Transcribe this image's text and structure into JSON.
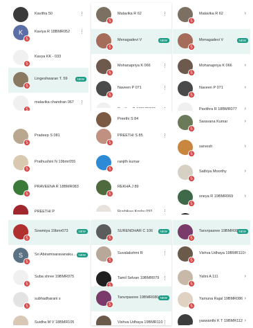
{
  "colors": {
    "accent": "#1c9c85",
    "badge": "#d94141",
    "active_row": "#e8f4f1"
  },
  "tiles": [
    {
      "rows": [
        {
          "name": "Kavitha 50",
          "avatar": "#3a3a3a",
          "badge": "",
          "trail": "⋮",
          "active": false
        },
        {
          "name": "Kaviya R 18BMR052",
          "avatar": "#5b6fa6",
          "avatar_letter": "K",
          "badge": "5",
          "trail": "⋮",
          "active": false
        },
        {
          "name": "Kavya KK - 033",
          "avatar": "#f0f0f0",
          "badge": "5",
          "trail": "",
          "active": false
        },
        {
          "name": "Lingeshwaran T. 59",
          "avatar": "#8a7a62",
          "badge": "5",
          "trail": "NEW",
          "active": true
        },
        {
          "name": "malavika chandran 067",
          "avatar": "#f0f0f0",
          "badge": "5",
          "trail": "⋮",
          "active": false
        },
        {
          "name": "",
          "avatar": "",
          "badge": "",
          "trail": "",
          "active": false,
          "cut": true
        }
      ]
    },
    {
      "rows": [
        {
          "name": "Malavika R 62",
          "avatar": "#7c7062",
          "badge": "5",
          "trail": "⋮",
          "active": false
        },
        {
          "name": "Menagadevi V",
          "avatar": "#a56c5a",
          "badge": "5",
          "trail": "NEW",
          "active": true
        },
        {
          "name": "Mohanapriya K 066",
          "avatar": "#6e5a4c",
          "badge": "5",
          "trail": "⋮",
          "active": false
        },
        {
          "name": "Naveen P 071",
          "avatar": "#4a4a4a",
          "badge": "5",
          "trail": "⋮",
          "active": false
        },
        {
          "name": "Pavithra R 18BMR077",
          "avatar": "#f0f0f0",
          "badge": "5",
          "trail": "⋮",
          "active": false
        }
      ]
    },
    {
      "rows": [
        {
          "name": "Malavika R 62",
          "avatar": "#7c7062",
          "badge": "5",
          "trail": "›",
          "active": false
        },
        {
          "name": "Menagadevi V",
          "avatar": "#a56c5a",
          "badge": "5",
          "trail": "NEW",
          "active": true
        },
        {
          "name": "Mohanapriya K 066",
          "avatar": "#6e5a4c",
          "badge": "5",
          "trail": "›",
          "active": false
        },
        {
          "name": "Naveen P 071",
          "avatar": "#4a4a4a",
          "badge": "5",
          "trail": "›",
          "active": false
        },
        {
          "name": "Pavithra R 18BMR077",
          "avatar": "#f0f0f0",
          "badge": "5",
          "trail": "›",
          "active": false
        }
      ]
    },
    {
      "rows": [
        {
          "name": "",
          "avatar": "",
          "badge": "",
          "trail": "",
          "active": false,
          "cut": true
        },
        {
          "name": "Pradeep S 081",
          "avatar": "#b9a78f",
          "badge": "5",
          "trail": "",
          "active": false
        },
        {
          "name": "Prathushini N 19bmr055",
          "avatar": "#d8c9b0",
          "badge": "5",
          "trail": "",
          "active": false
        },
        {
          "name": "PRAVEENA R 18BMR083",
          "avatar": "#3c7a3a",
          "badge": "5",
          "trail": "",
          "active": false
        },
        {
          "name": "PREETHI P",
          "avatar": "#a0282c",
          "badge": "5",
          "trail": "",
          "active": false
        }
      ]
    },
    {
      "rows": [
        {
          "name": "Preethi S 84",
          "avatar": "#7b5a44",
          "badge": "",
          "trail": "",
          "active": false
        },
        {
          "name": "PREETHI S 85",
          "avatar": "#c09080",
          "badge": "5",
          "trail": "⋮",
          "active": false
        },
        {
          "name": "ranjith kumar",
          "avatar": "#2d8ad6",
          "badge": "5",
          "trail": "",
          "active": false
        },
        {
          "name": "REKHA J 89",
          "avatar": "#4f6a3c",
          "badge": "5",
          "trail": "",
          "active": false
        },
        {
          "name": "Rushikaa Koshy 092",
          "avatar": "#e7e2dc",
          "badge": "5",
          "trail": "⋮",
          "active": false
        }
      ]
    },
    {
      "rows": [
        {
          "name": "Saravana Kumar",
          "avatar": "#6b7b5a",
          "badge": "5",
          "trail": "›",
          "active": false
        },
        {
          "name": "sarvesh",
          "avatar": "#c9863f",
          "badge": "5",
          "trail": "›",
          "active": false
        },
        {
          "name": "Sathiya Moorthy",
          "avatar": "#d7d0c5",
          "badge": "5",
          "trail": "›",
          "active": false
        },
        {
          "name": "sneya R 19BMR069",
          "avatar": "#3e6a4a",
          "badge": "5",
          "trail": "›",
          "active": false
        },
        {
          "name": "Sowmiya Kanagaraj 19BM...",
          "avatar": "#1e1e1e",
          "badge": "5",
          "trail": "›",
          "active": false
        }
      ]
    },
    {
      "rows": [
        {
          "name": "Sowmiya 19bmr073",
          "avatar": "#b03030",
          "badge": "5",
          "trail": "NEW",
          "active": true
        },
        {
          "name": "Sri Abiramisaravanaku...",
          "avatar": "#5b7285",
          "avatar_letter": "S",
          "badge": "5",
          "trail": "NEW",
          "active": false
        },
        {
          "name": "Suba shree 19BMR075",
          "avatar": "#f0f0f0",
          "badge": "5",
          "trail": "",
          "active": false
        },
        {
          "name": "subhadharani s",
          "avatar": "#e3e3e3",
          "badge": "5",
          "trail": "",
          "active": false
        },
        {
          "name": "Suidha M V 18BMR105",
          "avatar": "#d8c8b5",
          "badge": "",
          "trail": "",
          "active": false
        }
      ]
    },
    {
      "rows": [
        {
          "name": "SURENDHAR C 106",
          "avatar": "#5c5c5c",
          "badge": "5",
          "trail": "NEW",
          "active": true
        },
        {
          "name": "Suvalakshmi R",
          "avatar": "#b8a89a",
          "badge": "5",
          "trail": "⋮",
          "active": false
        },
        {
          "name": "Tamil Selvan 19BMR079",
          "avatar": "#202020",
          "badge": "5",
          "trail": "⋮",
          "active": false
        },
        {
          "name": "Tanvrpasree 19BMR080",
          "avatar": "#7a3a6a",
          "badge": "5",
          "trail": "NEW",
          "active": true
        },
        {
          "name": "Vishva Udhaya 19BMR110",
          "avatar": "#6a5a4a",
          "badge": "",
          "trail": "⋮",
          "active": false
        }
      ]
    },
    {
      "rows": [
        {
          "name": "Tanvrpasree 19BMR080",
          "avatar": "#7a3a6a",
          "badge": "5",
          "trail": "NEW",
          "active": true
        },
        {
          "name": "Vishva Udhaya 19BMR110",
          "avatar": "#6a5a4a",
          "badge": "5",
          "trail": "›",
          "active": false
        },
        {
          "name": "Yalini A 111",
          "avatar": "#c7b8a8",
          "badge": "5",
          "trail": "›",
          "active": false
        },
        {
          "name": "Yamuna Rajal 19BMR086",
          "avatar": "#e0d2c2",
          "badge": "5",
          "trail": "›",
          "active": false
        },
        {
          "name": "yaswanthi K T 19BMR112",
          "avatar": "#3d3d3d",
          "badge": "5",
          "trail": "›",
          "active": false
        }
      ]
    }
  ]
}
